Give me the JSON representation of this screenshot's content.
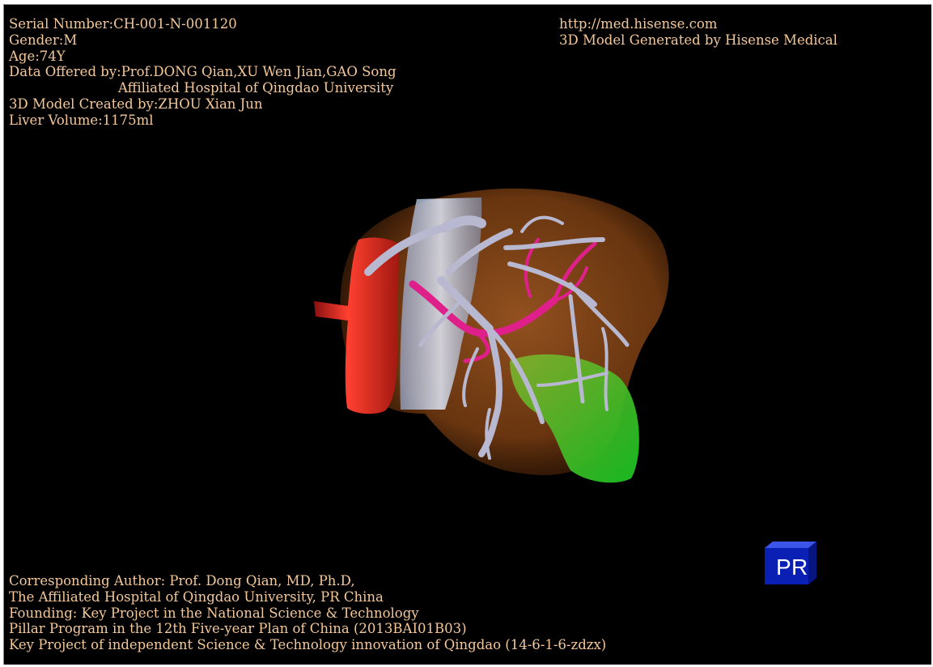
{
  "header_left": {
    "serial": "Serial Number:CH-001-N-001120",
    "gender": "Gender:M",
    "age": "Age:74Y",
    "data_offered": "Data Offered by:Prof.DONG Qian,XU Wen Jian,GAO Song",
    "hospital": "Affiliated Hospital of Qingdao University",
    "created_by": "3D Model Created by:ZHOU Xian Jun",
    "liver_volume": "Liver Volume:1175ml"
  },
  "header_right": {
    "url": "http://med.hisense.com",
    "generated_by": "3D Model Generated by Hisense Medical"
  },
  "footer": {
    "line1": "Corresponding Author: Prof. Dong Qian, MD, Ph.D,",
    "line2": "The Affiliated Hospital of Qingdao University, PR China",
    "line3": "Founding: Key Project in the National Science & Technology",
    "line4": "Pillar Program in the 12th Five-year Plan of China (2013BAI01B03)",
    "line5": "Key Project of independent Science & Technology innovation of Qingdao (14-6-1-6-zdzx)"
  },
  "orientation_cube": {
    "label_left": "P",
    "label_right": "R",
    "color": "#0a1fb4"
  },
  "colors": {
    "text": "#f4c89a",
    "background": "#000000",
    "liver": "#8a4a1a",
    "portal_vein": "#b8b8d0",
    "hepatic_artery": "#e0208a",
    "inferior_vena_cava": "#e03020",
    "gallbladder": "#30c020"
  }
}
